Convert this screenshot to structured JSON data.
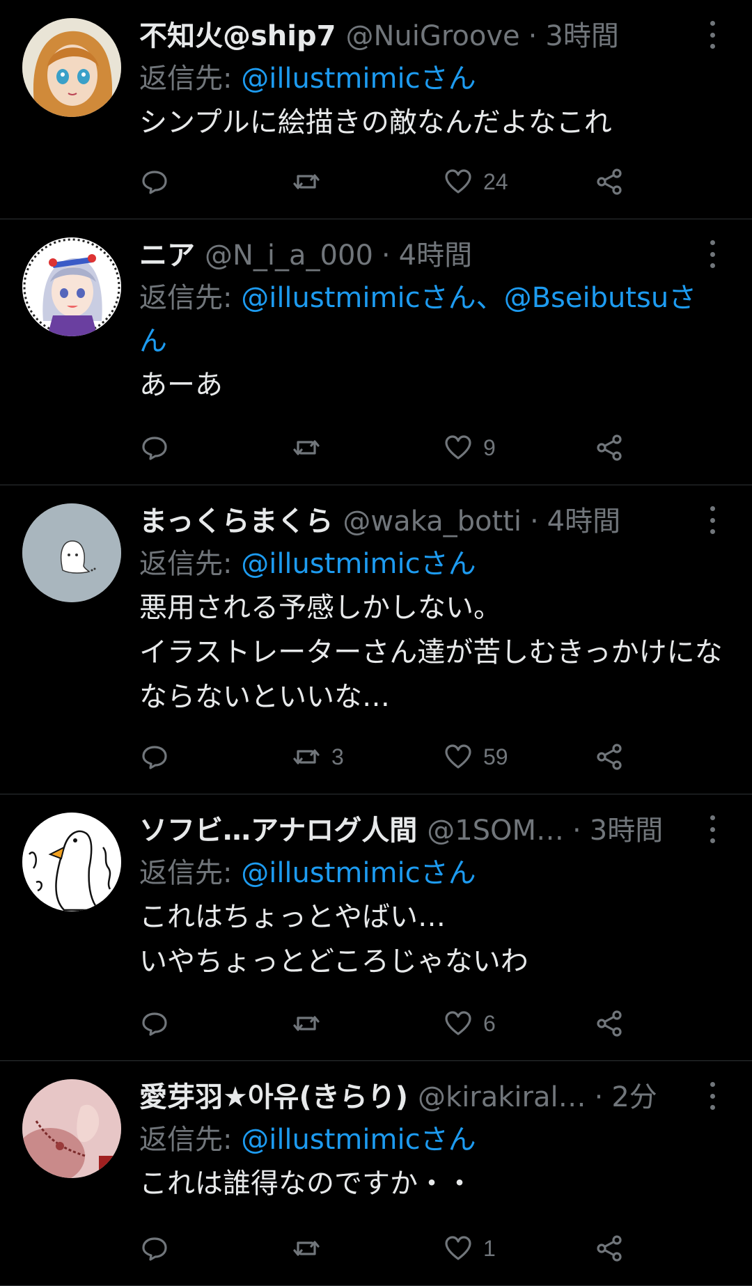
{
  "colors": {
    "background": "#000000",
    "text": "#e7e9ea",
    "secondary": "#71767b",
    "link": "#1d9bf0",
    "divider": "#2f3336"
  },
  "tweets": [
    {
      "name": "不知火@ship7",
      "handle": "@NuiGroove",
      "time": "3時間",
      "reply_prefix": "返信先: ",
      "reply_mentions": "@illustmimicさん",
      "reply_suffix": "",
      "body": "シンプルに絵描きの敵なんだよなこれ",
      "retweets": "",
      "likes": "24",
      "avatar": "anime-girl-avatar"
    },
    {
      "name": "ニア",
      "handle": "@N_i_a_000",
      "time": "4時間",
      "reply_prefix": "返信先: ",
      "reply_mentions": "@illustmimicさん、@Bseibutsuさん",
      "reply_suffix": "",
      "body": "あーあ",
      "retweets": "",
      "likes": "9",
      "avatar": "silver-hair-girl-avatar"
    },
    {
      "name": "まっくらまくら",
      "handle": "@waka_botti",
      "time": "4時間",
      "reply_prefix": "返信先: ",
      "reply_mentions": "@illustmimicさん",
      "reply_suffix": "",
      "body": "悪用される予感しかしない。\nイラストレーターさん達が苦しむきっかけになならないといいな…",
      "retweets": "3",
      "likes": "59",
      "avatar": "ghost-avatar"
    },
    {
      "name": "ソフビ…アナログ人間",
      "handle": "@1SOM…",
      "time": "3時間",
      "reply_prefix": "返信先: ",
      "reply_mentions": "@illustmimicさん",
      "reply_suffix": "",
      "body": "これはちょっとやばい…\nいやちょっとどころじゃないわ",
      "retweets": "",
      "likes": "6",
      "avatar": "duck-avatar"
    },
    {
      "name": "愛芽羽★아유(きらり)",
      "handle": "@kirakiral…",
      "time": "2分",
      "reply_prefix": "返信先: ",
      "reply_mentions": "@illustmimicさん",
      "reply_suffix": "",
      "body": "これは誰得なのですか・・",
      "retweets": "",
      "likes": "1",
      "avatar": "photo-avatar"
    }
  ]
}
